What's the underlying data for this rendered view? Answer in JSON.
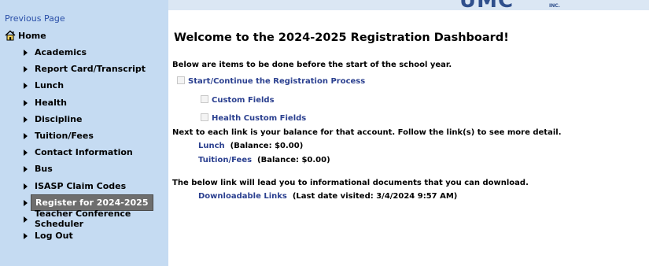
{
  "header": {
    "logo_text": "UMC",
    "logo_suffix": "INC."
  },
  "sidebar": {
    "previous_page": "Previous Page",
    "home": "Home",
    "items": [
      {
        "label": "Academics"
      },
      {
        "label": "Report Card/Transcript"
      },
      {
        "label": "Lunch"
      },
      {
        "label": "Health"
      },
      {
        "label": "Discipline"
      },
      {
        "label": "Tuition/Fees"
      },
      {
        "label": "Contact Information"
      },
      {
        "label": "Bus"
      },
      {
        "label": "ISASP Claim Codes"
      },
      {
        "label": "Register for 2024-2025",
        "active": true
      },
      {
        "label": "Teacher Conference Scheduler"
      },
      {
        "label": "Log Out"
      }
    ]
  },
  "main": {
    "title": "Welcome to the 2024-2025 Registration Dashboard!",
    "intro": "Below are items to be done before the start of the school year.",
    "tasks": {
      "registration": "Start/Continue the Registration Process",
      "custom_fields": "Custom Fields",
      "health_custom_fields": "Health Custom Fields"
    },
    "balance_intro": "Next to each link is your balance for that account. Follow the link(s) to see more detail.",
    "balances": {
      "lunch_link": "Lunch",
      "lunch_balance": "(Balance: $0.00)",
      "tuition_link": "Tuition/Fees",
      "tuition_balance": "(Balance: $0.00)"
    },
    "docs_intro": "The below link will lead you to informational documents that you can download.",
    "docs": {
      "link": "Downloadable Links",
      "last_visited": "(Last date visited: 3/4/2024 9:57 AM)"
    }
  }
}
